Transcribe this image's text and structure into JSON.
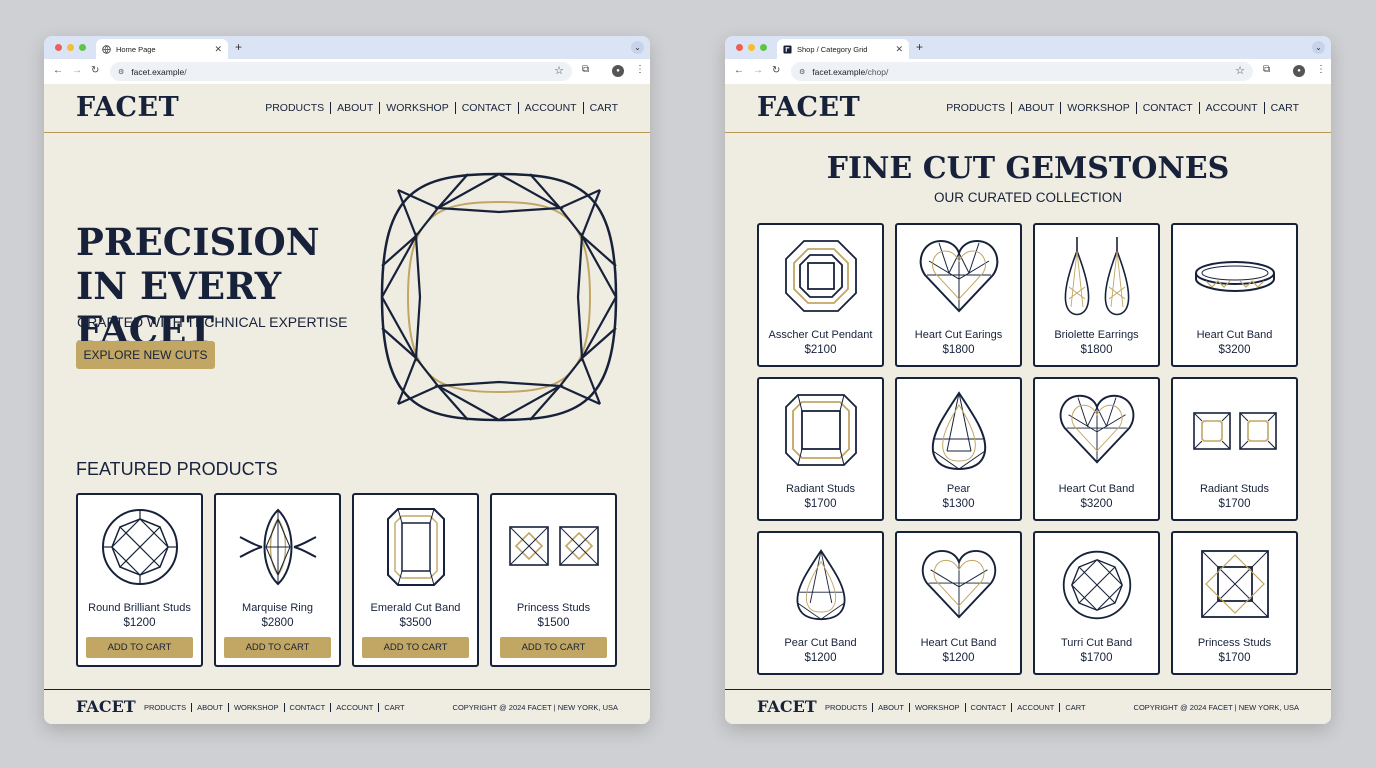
{
  "colors": {
    "navy": "#17223a",
    "gold": "#c2a663",
    "cream": "#efece2"
  },
  "left_window": {
    "tab_title": "Home Page",
    "url_host": "facet.example",
    "url_path": "/",
    "logo": "FACET",
    "nav": [
      "PRODUCTS",
      "ABOUT",
      "WORKSHOP",
      "CONTACT",
      "ACCOUNT",
      "CART"
    ],
    "hero": {
      "title": "PRECISION IN EVERY FACET",
      "subtitle": "CRAFTED WITH TECHNICAL EXPERTISE",
      "cta": "EXPLORE NEW CUTS"
    },
    "featured_title": "FEATURED PRODUCTS",
    "products": [
      {
        "name": "Round Brilliant Studs",
        "price": "$1200",
        "icon": "round-brilliant-icon",
        "cta": "ADD TO CART"
      },
      {
        "name": "Marquise Ring",
        "price": "$2800",
        "icon": "marquise-ring-icon",
        "cta": "ADD TO CART"
      },
      {
        "name": "Emerald Cut Band",
        "price": "$3500",
        "icon": "emerald-cut-icon",
        "cta": "ADD TO CART"
      },
      {
        "name": "Princess Studs",
        "price": "$1500",
        "icon": "princess-studs-icon",
        "cta": "ADD TO CART"
      }
    ],
    "footer": {
      "logo": "FACET",
      "nav": [
        "PRODUCTS",
        "ABOUT",
        "WORKSHOP",
        "CONTACT",
        "ACCOUNT",
        "CART"
      ],
      "copyright": "COPYRIGHT @ 2024 FACET | NEW YORK, USA"
    }
  },
  "right_window": {
    "tab_title": "Shop / Category Grid",
    "url_host": "facet.example",
    "url_path": "/chop/",
    "logo": "FACET",
    "nav": [
      "PRODUCTS",
      "ABOUT",
      "WORKSHOP",
      "CONTACT",
      "ACCOUNT",
      "CART"
    ],
    "title": "FINE CUT GEMSTONES",
    "subtitle": "OUR CURATED COLLECTION",
    "products": [
      {
        "name": "Asscher Cut Pendant",
        "price": "$2100",
        "icon": "asscher-cut-icon"
      },
      {
        "name": "Heart Cut Earings",
        "price": "$1800",
        "icon": "heart-cut-icon"
      },
      {
        "name": "Briolette Earrings",
        "price": "$1800",
        "icon": "briolette-earrings-icon"
      },
      {
        "name": "Heart Cut Band",
        "price": "$3200",
        "icon": "band-ring-icon"
      },
      {
        "name": "Radiant Studs",
        "price": "$1700",
        "icon": "radiant-cut-icon"
      },
      {
        "name": "Pear",
        "price": "$1300",
        "icon": "pear-cut-icon"
      },
      {
        "name": "Heart Cut Band",
        "price": "$3200",
        "icon": "heart-cut-icon"
      },
      {
        "name": "Radiant Studs",
        "price": "$1700",
        "icon": "radiant-studs-icon"
      },
      {
        "name": "Pear Cut Band",
        "price": "$1200",
        "icon": "pear-cut-icon"
      },
      {
        "name": "Heart Cut Band",
        "price": "$1200",
        "icon": "heart-cut-icon"
      },
      {
        "name": "Turri Cut Band",
        "price": "$1700",
        "icon": "round-brilliant-icon"
      },
      {
        "name": "Princess Studs",
        "price": "$1700",
        "icon": "princess-cut-icon"
      }
    ],
    "footer": {
      "logo": "FACET",
      "nav": [
        "PRODUCTS",
        "ABOUT",
        "WORKSHOP",
        "CONTACT",
        "ACCOUNT",
        "CART"
      ],
      "copyright": "COPYRIGHT @ 2024 FACET | NEW YORK, USA"
    }
  }
}
